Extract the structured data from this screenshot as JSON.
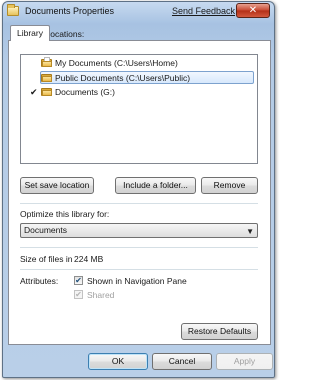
{
  "window": {
    "title": "Documents Properties",
    "feedback_link": "Send Feedback",
    "close_glyph": "✕"
  },
  "tabs": [
    {
      "label": "Library"
    }
  ],
  "library": {
    "locations_label": "Library locations:",
    "locations": [
      {
        "label": "My Documents (C:\\Users\\Home)",
        "selected": false,
        "default": false,
        "icon": "folder-icon"
      },
      {
        "label": "Public Documents (C:\\Users\\Public)",
        "selected": true,
        "default": false,
        "icon": "folder-icon"
      },
      {
        "label": "Documents (G:)",
        "selected": false,
        "default": true,
        "icon": "folder-icon"
      }
    ],
    "default_mark": "✔",
    "set_save_location": "Set save location",
    "include_folder": "Include a folder...",
    "remove": "Remove",
    "optimize_label": "Optimize this library for:",
    "optimize_value": "Documents",
    "size_label": "Size of files in",
    "size_value": "224 MB",
    "attributes_label": "Attributes:",
    "shown_in_nav": {
      "label": "Shown in Navigation Pane",
      "checked": true
    },
    "shared": {
      "label": "Shared",
      "checked": true,
      "disabled": true
    },
    "check_glyph": "✔",
    "restore_defaults": "Restore Defaults"
  },
  "dialog_buttons": {
    "ok": "OK",
    "cancel": "Cancel",
    "apply": "Apply"
  },
  "colors": {
    "selection_border": "#7da2ce",
    "title_gradient_top": "#c7daf0",
    "close_red": "#c7472f"
  }
}
